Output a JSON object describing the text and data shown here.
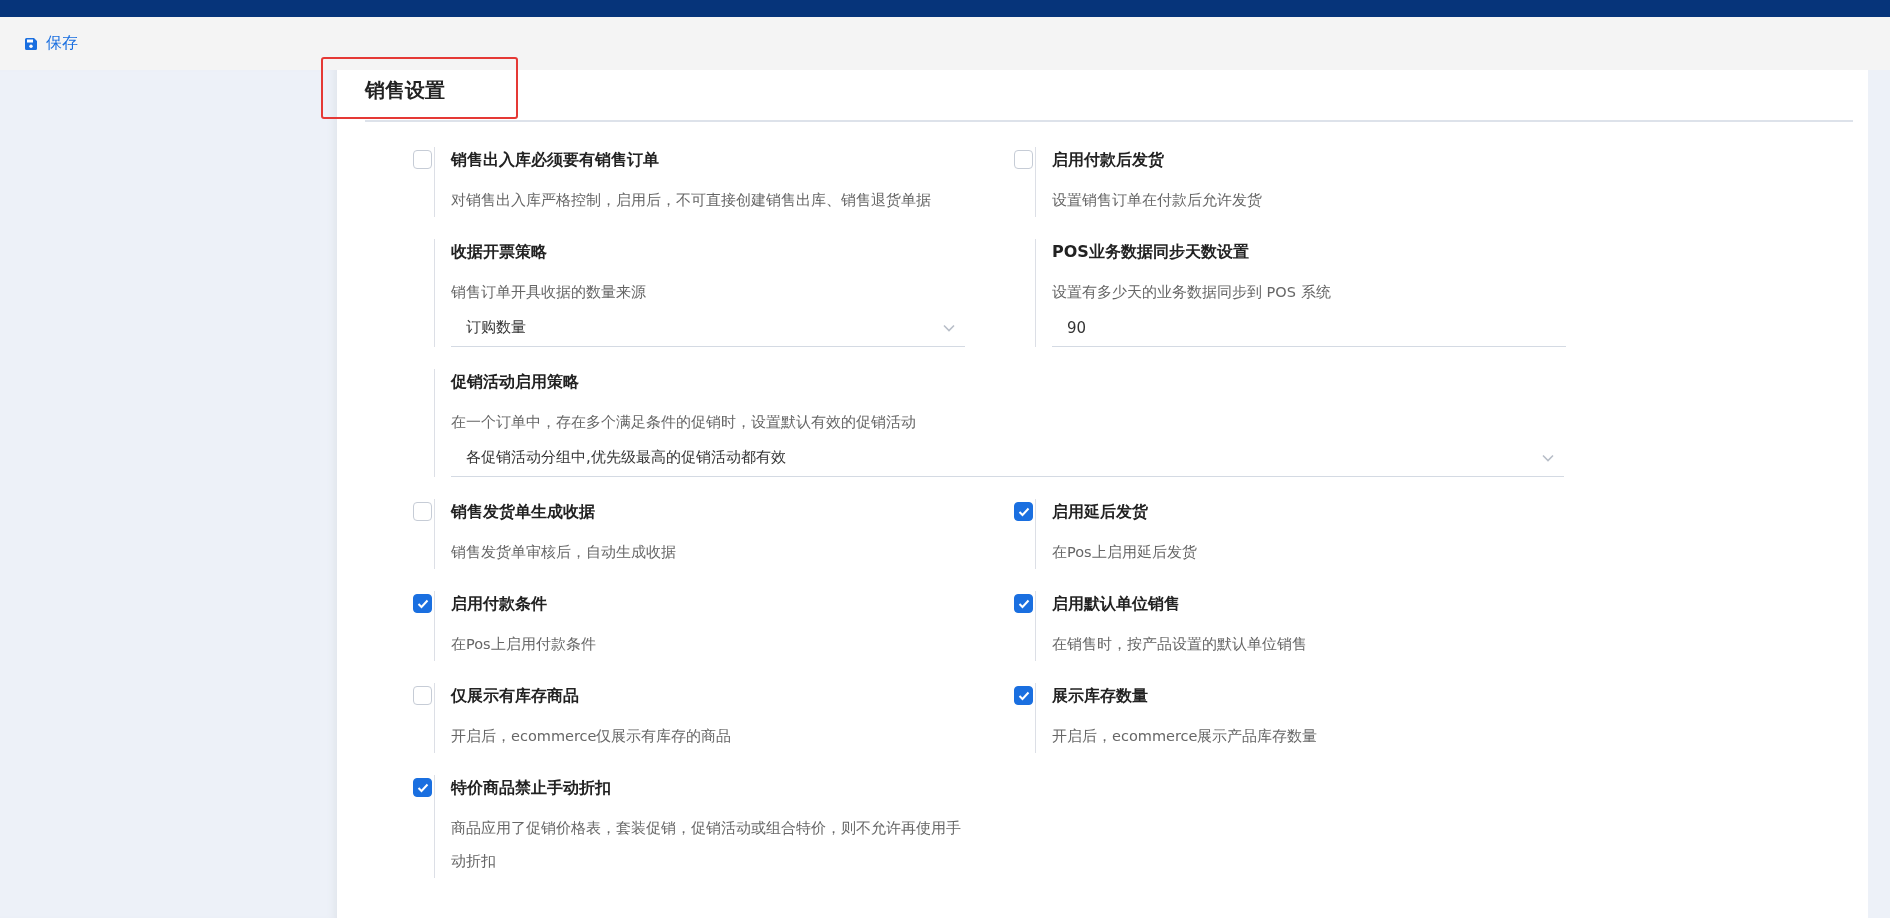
{
  "toolbar": {
    "save_label": "保存"
  },
  "section": {
    "title": "销售设置",
    "highlighted": true
  },
  "settings": [
    {
      "kind": "checkbox",
      "checked": false,
      "full_width": false,
      "title": "销售出入库必须要有销售订单",
      "description": "对销售出入库严格控制，启用后，不可直接创建销售出库、销售退货单据"
    },
    {
      "kind": "checkbox",
      "checked": false,
      "full_width": false,
      "title": "启用付款后发货",
      "description": "设置销售订单在付款后允许发货"
    },
    {
      "kind": "select",
      "full_width": false,
      "title": "收据开票策略",
      "description": "销售订单开具收据的数量来源",
      "value": "订购数量"
    },
    {
      "kind": "input",
      "full_width": false,
      "title": "POS业务数据同步天数设置",
      "description": "设置有多少天的业务数据同步到 POS 系统",
      "value": "90"
    },
    {
      "kind": "select",
      "full_width": true,
      "title": "促销活动启用策略",
      "description": "在一个订单中，存在多个满足条件的促销时，设置默认有效的促销活动",
      "value": "各促销活动分组中,优先级最高的促销活动都有效"
    },
    {
      "kind": "checkbox",
      "checked": false,
      "full_width": false,
      "title": "销售发货单生成收据",
      "description": "销售发货单审核后，自动生成收据"
    },
    {
      "kind": "checkbox",
      "checked": true,
      "full_width": false,
      "title": "启用延后发货",
      "description": "在Pos上启用延后发货"
    },
    {
      "kind": "checkbox",
      "checked": true,
      "full_width": false,
      "title": "启用付款条件",
      "description": "在Pos上启用付款条件"
    },
    {
      "kind": "checkbox",
      "checked": true,
      "full_width": false,
      "title": "启用默认单位销售",
      "description": "在销售时，按产品设置的默认单位销售"
    },
    {
      "kind": "checkbox",
      "checked": false,
      "full_width": false,
      "title": "仅展示有库存商品",
      "description": "开启后，ecommerce仅展示有库存的商品"
    },
    {
      "kind": "checkbox",
      "checked": true,
      "full_width": false,
      "title": "展示库存数量",
      "description": "开启后，ecommerce展示产品库存数量"
    },
    {
      "kind": "checkbox",
      "checked": true,
      "full_width": false,
      "title": "特价商品禁止手动折扣",
      "description": "商品应用了促销价格表，套装促销，促销活动或组合特价，则不允许再使用手动折扣"
    }
  ]
}
